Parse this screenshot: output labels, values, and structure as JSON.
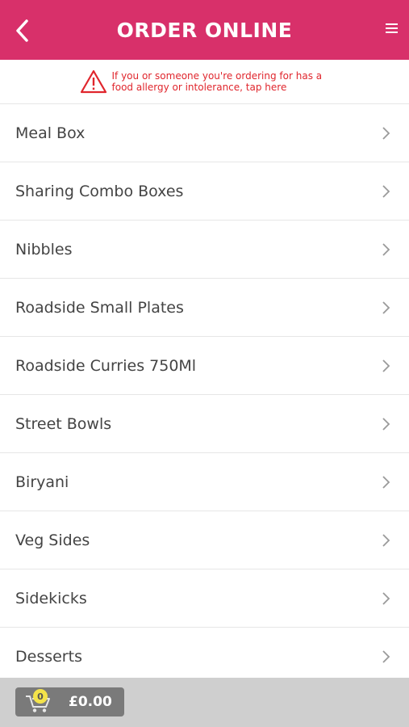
{
  "header": {
    "title": "ORDER ONLINE"
  },
  "allergy": {
    "message": "If you or someone you're ordering for has a food allergy or intolerance, tap here"
  },
  "menu": {
    "items": [
      {
        "label": "Meal Box"
      },
      {
        "label": "Sharing Combo Boxes"
      },
      {
        "label": "Nibbles"
      },
      {
        "label": "Roadside Small Plates"
      },
      {
        "label": "Roadside Curries 750Ml"
      },
      {
        "label": "Street Bowls"
      },
      {
        "label": "Biryani"
      },
      {
        "label": "Veg Sides"
      },
      {
        "label": "Sidekicks"
      },
      {
        "label": "Desserts"
      }
    ]
  },
  "cart": {
    "count": "0",
    "total": "£0.00"
  },
  "colors": {
    "brand": "#d8306a",
    "warning": "#e0262d",
    "badge": "#f4e34a"
  }
}
